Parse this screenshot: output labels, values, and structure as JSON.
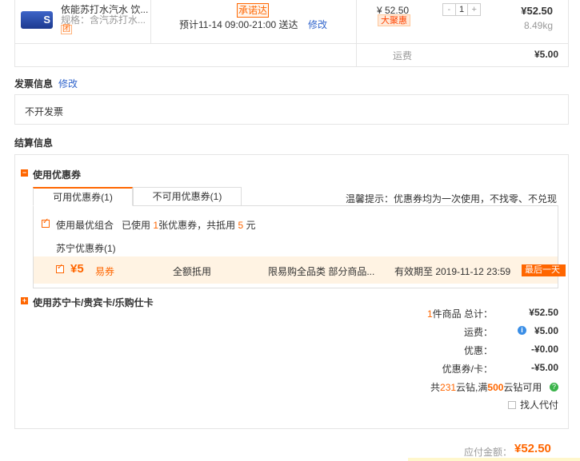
{
  "product": {
    "name": "依能苏打水汽水 饮...",
    "spec": "规格：含汽苏打水...",
    "tuan": "团",
    "thumb_label": "S",
    "promise_badge": "承诺达",
    "delivery_text": "预计11-14 09:00-21:00 送达",
    "delivery_edit": "修改",
    "price": "¥ 52.50",
    "promo_badge": "大聚惠",
    "qty_minus": "-",
    "qty_value": "1",
    "qty_plus": "+",
    "subtotal": "¥52.50",
    "weight": "8.49kg"
  },
  "shipping_row": {
    "label": "运费",
    "value": "¥5.00"
  },
  "invoice": {
    "title": "发票信息",
    "edit": "修改",
    "value": "不开发票"
  },
  "settlement": {
    "title": "结算信息",
    "coupon_section": {
      "toggle": "−",
      "title": "使用优惠券",
      "tabs": [
        {
          "label": "可用优惠券(1)"
        },
        {
          "label": "不可用优惠券(1)"
        }
      ],
      "tip": "温馨提示：优惠券均为一次使用，不找零、不兑现",
      "best_combo": {
        "label": "使用最优组合",
        "text_prefix": "已使用",
        "count": "1",
        "text_mid": "张优惠券，共抵用",
        "amount": "5",
        "text_suffix": "元"
      },
      "group_title": "苏宁优惠券(1)",
      "coupon": {
        "amount": "¥5",
        "kind": "易券",
        "scope": "全额抵用",
        "limit": "限易购全品类 部分商品...",
        "expire": "有效期至 2019-11-12 23:59",
        "tag": "最后一天"
      }
    },
    "card_section": {
      "toggle": "+",
      "title": "使用苏宁卡/贵宾卡/乐购仕卡"
    },
    "summary": {
      "items_count": "1",
      "items_label": "件商品  总计：",
      "items_value": "¥52.50",
      "freight_label": "运费：",
      "freight_value": "¥5.00",
      "discount_label": "优惠：",
      "discount_value": "-¥0.00",
      "coupon_label": "优惠券/卡：",
      "coupon_value": "-¥5.00",
      "cloud_prefix": "共",
      "cloud_count": "231",
      "cloud_mid": "云钻,满",
      "cloud_threshold": "500",
      "cloud_suffix": "云钻可用",
      "proxy_pay": "找人代付"
    },
    "payable_label": "应付金额：",
    "payable_value": "¥52.50"
  },
  "colors": {
    "accent": "#ff6600",
    "link": "#3366cc",
    "border": "#e5e5e5"
  }
}
